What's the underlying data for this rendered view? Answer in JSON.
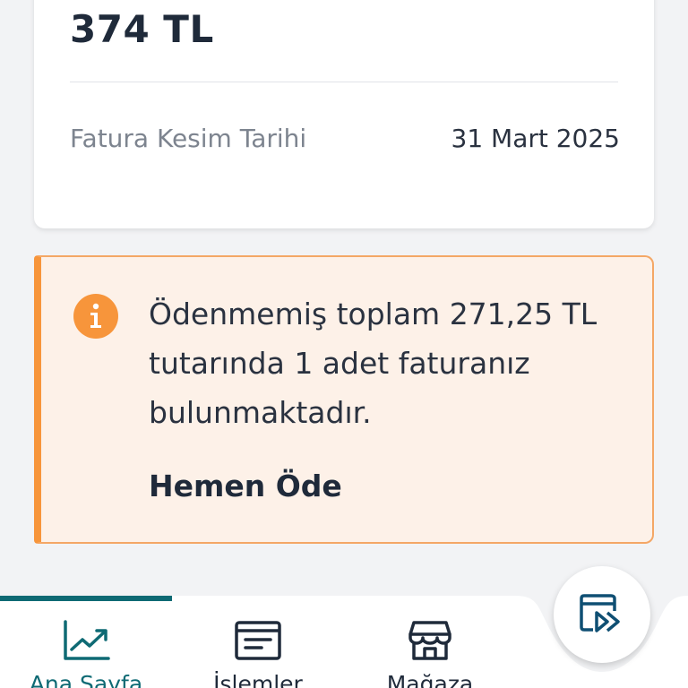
{
  "bill": {
    "amount": "374 TL",
    "date_label": "Fatura Kesim Tarihi",
    "date_value": "31 Mart 2025"
  },
  "notice": {
    "icon": "info-icon",
    "message": "Ödenmemiş toplam 271,25 TL tutarında 1 adet faturanız bulunmaktadır.",
    "action_label": "Hemen Öde",
    "accent_color": "#f7953b",
    "background_color": "#fdf1e8"
  },
  "bottom_nav": {
    "active_color": "#0e6a74",
    "items": [
      {
        "label": "Ana Sayfa",
        "icon": "chart-trend-icon",
        "active": true
      },
      {
        "label": "İşlemler",
        "icon": "receipt-icon",
        "active": false
      },
      {
        "label": "Mağaza",
        "icon": "store-icon",
        "active": false
      }
    ],
    "fab_icon": "fast-forward-window-icon"
  }
}
